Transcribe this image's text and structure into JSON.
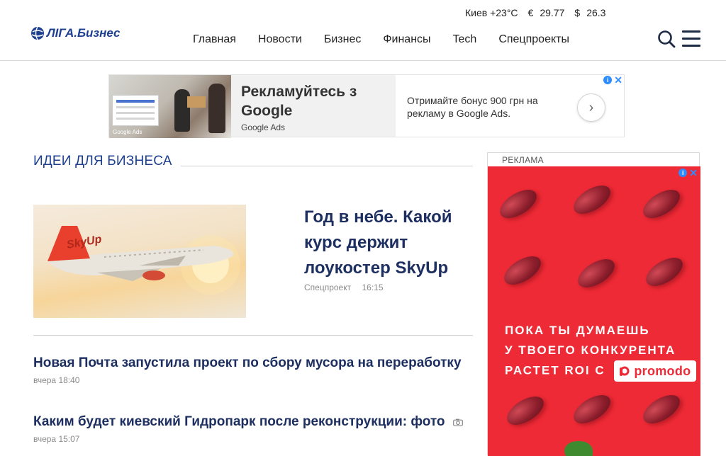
{
  "header": {
    "logo_text": "ЛІГА.Бизнес",
    "weather": "Киев +23°C",
    "currency": [
      {
        "symbol": "€",
        "value": "29.77"
      },
      {
        "symbol": "$",
        "value": "26.3"
      }
    ],
    "nav": [
      "Главная",
      "Новости",
      "Бизнес",
      "Финансы",
      "Tech",
      "Спецпроекты"
    ]
  },
  "top_ad": {
    "image_label": "Google Ads",
    "headline": "Рекламуйтесь з Google",
    "brand": "Google Ads",
    "description": "Отримайте бонус 900 грн на рекламу в Google Ads.",
    "arrow": "›"
  },
  "section": {
    "title": "ИДЕИ ДЛЯ БИЗНЕСА",
    "featured": {
      "title": "Год в небе. Какой курс держит лоукостер SkyUp",
      "category": "Спецпроект",
      "time": "16:15",
      "image_text": "SkyUp"
    },
    "news": [
      {
        "title": "Новая Почта запустила проект по сбору мусора на переработку",
        "date": "вчера 18:40"
      },
      {
        "title": "Каким будет киевский Гидропарк после реконструкции: фото",
        "date": "вчера 15:07",
        "icon": "camera-icon"
      }
    ]
  },
  "side_ad": {
    "label": "РЕКЛАМА",
    "lines": [
      "ПОКА ТЫ ДУМАЕШЬ",
      "У ТВОЕГО КОНКУРЕНТА",
      "РАСТЕТ ROI С"
    ],
    "brand": "promodo",
    "bg_color": "#ee2a36"
  },
  "colors": {
    "brand": "#1d3f8f",
    "headline": "#1d2f60",
    "meta": "#8a8a8a"
  }
}
